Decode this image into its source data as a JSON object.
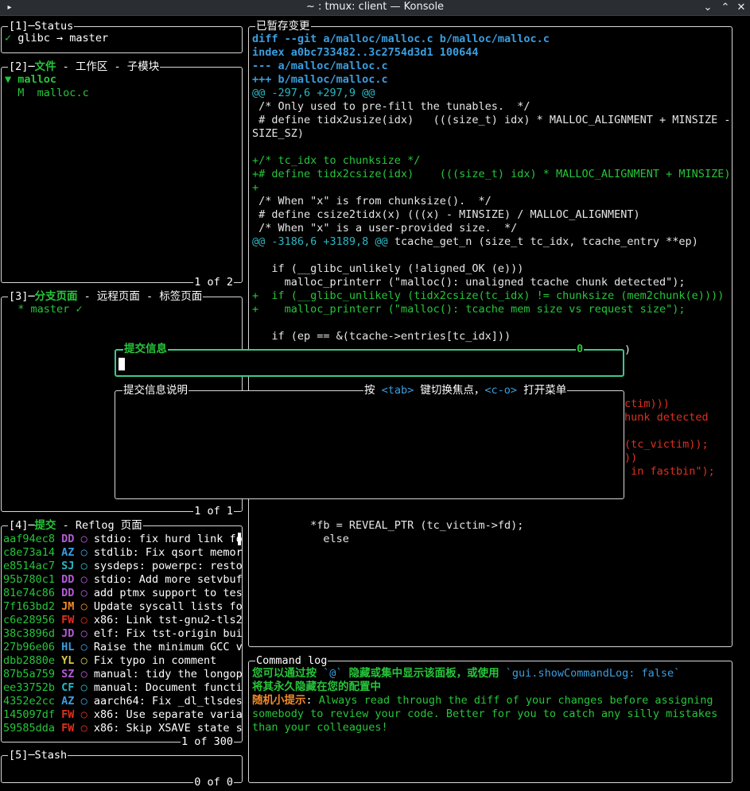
{
  "window": {
    "title": "~ : tmux: client — Konsole"
  },
  "status": {
    "title": "[1]─Status",
    "repo": "glibc → master",
    "check": "✓"
  },
  "files": {
    "title_num": "[2]─",
    "title_active": "文件",
    "title_rest": " - 工作区 - 子模块",
    "dir_marker": "▼",
    "dir": "malloc",
    "file_status": "M",
    "file": "malloc.c",
    "footer": "1 of 2"
  },
  "branches": {
    "title_num": "[3]─",
    "title_active": "分支页面",
    "title_rest": " - 远程页面 - 标签页面",
    "branch": "* master",
    "check": "✓",
    "footer": "1 of 1"
  },
  "commits": {
    "title_num": "[4]─",
    "title_active": "提交",
    "title_rest": " - Reflog 页面",
    "footer": "1 of 300",
    "rows": [
      {
        "hash": "aaf94ec8",
        "author": "DD",
        "acolor": "#b45ad6",
        "msg": "stdio: fix hurd link fo"
      },
      {
        "hash": "c8e73a14",
        "author": "AZ",
        "acolor": "#3a9ee0",
        "msg": "stdlib: Fix qsort memor"
      },
      {
        "hash": "e8514ac7",
        "author": "SJ",
        "acolor": "#2ab8c4",
        "msg": "sysdeps: powerpc: resto"
      },
      {
        "hash": "95b780c1",
        "author": "DD",
        "acolor": "#b45ad6",
        "msg": "stdio: Add more setvbuf"
      },
      {
        "hash": "81e74c86",
        "author": "DD",
        "acolor": "#b45ad6",
        "msg": "add ptmx support to tes"
      },
      {
        "hash": "7f163bd2",
        "author": "JM",
        "acolor": "#ef8a2a",
        "msg": "Update syscall lists fo"
      },
      {
        "hash": "c6e28956",
        "author": "FW",
        "acolor": "#e0301e",
        "msg": "x86: Link tst-gnu2-tls2"
      },
      {
        "hash": "38c3896d",
        "author": "JD",
        "acolor": "#b45ad6",
        "msg": "elf: Fix tst-origin bui"
      },
      {
        "hash": "27b96e06",
        "author": "HL",
        "acolor": "#3a9ee0",
        "msg": "Raise the minimum GCC v"
      },
      {
        "hash": "dbb2880e",
        "author": "YL",
        "acolor": "#d6c84a",
        "msg": "Fix typo in comment"
      },
      {
        "hash": "87b5a759",
        "author": "SZ",
        "acolor": "#b45ad6",
        "msg": "manual: tidy the longop"
      },
      {
        "hash": "ee33752b",
        "author": "CF",
        "acolor": "#2ab8c4",
        "msg": "manual: Document functi"
      },
      {
        "hash": "4352e2cc",
        "author": "AZ",
        "acolor": "#3a9ee0",
        "msg": "aarch64: Fix _dl_tlsdes"
      },
      {
        "hash": "145097df",
        "author": "FW",
        "acolor": "#e0301e",
        "msg": "x86: Use separate varia"
      },
      {
        "hash": "59585dda",
        "author": "FW",
        "acolor": "#e0301e",
        "msg": "x86: Skip XSAVE state s"
      }
    ]
  },
  "stash": {
    "title": "[5]─Stash",
    "footer": "0 of 0"
  },
  "staged": {
    "title": "已暂存变更",
    "lines": [
      {
        "t": "diff --git a/malloc/malloc.c b/malloc/malloc.c",
        "c": "cy"
      },
      {
        "t": "index a0bc733482..3c2754d3d1 100644",
        "c": "cy"
      },
      {
        "t": "--- a/malloc/malloc.c",
        "c": "cy"
      },
      {
        "t": "+++ b/malloc/malloc.c",
        "c": "cy"
      },
      {
        "t": "@@ -297,6 +297,9 @@",
        "c": "cmt"
      },
      {
        "t": " /* Only used to pre-fill the tunables.  */",
        "c": "wt"
      },
      {
        "t": " # define tidx2usize(idx)   (((size_t) idx) * MALLOC_ALIGNMENT + MINSIZE -",
        "c": "wt"
      },
      {
        "t": "SIZE_SZ)",
        "c": "wt"
      },
      {
        "t": "",
        "c": "wt"
      },
      {
        "t": "+/* tc_idx to chunksize */",
        "c": "g"
      },
      {
        "t": "+# define tidx2csize(idx)    (((size_t) idx) * MALLOC_ALIGNMENT + MINSIZE)",
        "c": "g"
      },
      {
        "t": "+",
        "c": "g"
      },
      {
        "t": " /* When \"x\" is from chunksize().  */",
        "c": "wt"
      },
      {
        "t": " # define csize2tidx(x) (((x) - MINSIZE) / MALLOC_ALIGNMENT)",
        "c": "wt"
      },
      {
        "t": " /* When \"x\" is a user-provided size.  */",
        "c": "wt"
      },
      {
        "t": "@@ -3186,6 +3189,8 @@",
        "c": "cmt",
        "rest": " tcache_get_n (size_t tc_idx, tcache_entry **ep)"
      },
      {
        "t": "",
        "c": "wt"
      },
      {
        "t": "   if (__glibc_unlikely (!aligned_OK (e)))",
        "c": "wt"
      },
      {
        "t": "     malloc_printerr (\"malloc(): unaligned tcache chunk detected\");",
        "c": "wt"
      },
      {
        "t": "+  if (__glibc_unlikely (tidx2csize(tc_idx) != chunksize (mem2chunk(e))))",
        "c": "g"
      },
      {
        "t": "+    malloc_printerr (\"malloc(): tcache mem size vs request size\");",
        "c": "g"
      },
      {
        "t": "",
        "c": "wt"
      },
      {
        "t": "   if (ep == &(tcache->entries[tc_idx]))",
        "c": "wt"
      }
    ],
    "hidden_fragments": [
      {
        "t": ")",
        "c": "wt",
        "row": 24
      },
      {
        "t": "ctim)))",
        "c": "rd",
        "row": 28
      },
      {
        "t": "hunk detected",
        "c": "rd",
        "row": 29
      },
      {
        "t": "(tc_victim));",
        "c": "rd",
        "row": 31
      },
      {
        "t": "))",
        "c": "rd",
        "row": 32
      },
      {
        "t": " in fastbin\");",
        "c": "rd",
        "row": 33
      }
    ],
    "tail_lines": [
      {
        "t": "         *fb = REVEAL_PTR (tc_victim->fd);",
        "c": "wt"
      },
      {
        "t": "           else",
        "c": "wt"
      }
    ]
  },
  "commit_summary": {
    "title": "提交信息",
    "count": "0",
    "value": ""
  },
  "commit_description": {
    "title": "提交信息说明",
    "hint_prefix": "按 ",
    "hint_key1": "<tab>",
    "hint_mid": " 键切换焦点，",
    "hint_key2": "<c-o>",
    "hint_suffix": " 打开菜单"
  },
  "command_log": {
    "title": "Command log",
    "line1a": "您可以通过按 ",
    "line1b": "`@`",
    "line1c": " 隐藏或集中显示该面板，或使用 ",
    "line1d": "`gui.showCommandLog: false`",
    "line2": "将其永久隐藏在您的配置中",
    "tip_label": "随机小提示",
    "tip_sep": ": ",
    "tip_1": "Always read through the diff of your changes before assigning",
    "tip_2": "somebody to review your code. Better for you to catch any silly mistakes",
    "tip_3": "than your colleagues!"
  },
  "colors": {
    "accent_green": "#26c63a",
    "modal_border": "#3ec88c",
    "cyan": "#3a9ee0",
    "red": "#e0301e"
  }
}
